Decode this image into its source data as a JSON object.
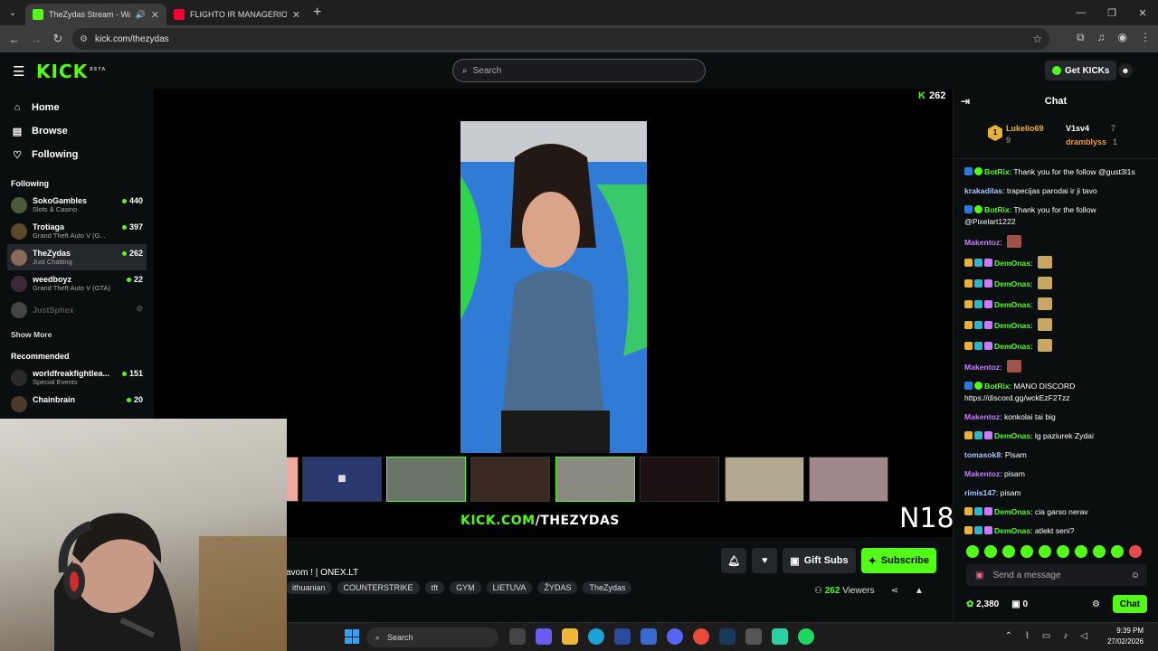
{
  "browser": {
    "tabs": [
      {
        "title": "TheZydas Stream - Watch L",
        "active": true,
        "audio": "🔊"
      },
      {
        "title": "FLIGHTO IR MANAGERIO PIRM",
        "active": false
      }
    ],
    "url": "kick.com/thezydas"
  },
  "header": {
    "logo": "KICK",
    "logo_beta": "BETA",
    "search_placeholder": "Search",
    "get_kicks": "Get KICKs"
  },
  "sidebar": {
    "nav": [
      {
        "label": "Home",
        "icon": "home-icon"
      },
      {
        "label": "Browse",
        "icon": "browse-icon"
      },
      {
        "label": "Following",
        "icon": "heart-icon"
      }
    ],
    "following_title": "Following",
    "following": [
      {
        "name": "SokoGambles",
        "category": "Slots & Casino",
        "viewers": "440"
      },
      {
        "name": "Trotiaga",
        "category": "Grand Theft Auto V (G...",
        "viewers": "397"
      },
      {
        "name": "TheZydas",
        "category": "Just Chatting",
        "viewers": "262",
        "selected": true
      },
      {
        "name": "weedboyz",
        "category": "Grand Theft Auto V (GTA)",
        "viewers": "22"
      },
      {
        "name": "JustSphex",
        "category": "",
        "viewers": "",
        "offline": true
      }
    ],
    "show_more": "Show More",
    "recommended_title": "Recommended",
    "recommended": [
      {
        "name": "worldfreakfightlea...",
        "category": "Special Events",
        "viewers": "151"
      },
      {
        "name": "Chainbrain",
        "category": "",
        "viewers": "20"
      }
    ]
  },
  "player": {
    "viewer_count": "262",
    "watermark_green": "KICK.COM",
    "watermark_white": "/THEZYDAS",
    "rating": "N18"
  },
  "stream_info": {
    "title": "avom ! | ONEX.LT",
    "tags": [
      "ithuanian",
      "COUNTERSTRIKE",
      "tft",
      "GYM",
      "LIETUVA",
      "ŽYDAS",
      "TheZydas"
    ],
    "gift_subs": "Gift Subs",
    "subscribe": "Subscribe",
    "viewers_count": "262",
    "viewers_label": "Viewers"
  },
  "chat": {
    "title": "Chat",
    "leaders": [
      {
        "rank": "1",
        "name": "Lukelio69",
        "count": "9"
      },
      {
        "name": "V1sv4",
        "count": "7"
      },
      {
        "name": "dramblyss",
        "count": "1"
      }
    ],
    "messages": [
      {
        "user": "BotRix",
        "color": "#53fc18",
        "text": "Thank you for the follow @gust3l1s",
        "bot": true
      },
      {
        "user": "krakadilas",
        "color": "#a7c8ff",
        "text": "trapecijas parodai ir ji tavo"
      },
      {
        "user": "BotRix",
        "color": "#53fc18",
        "text": "Thank you for the follow @Pixelart1222",
        "bot": true
      },
      {
        "user": "Makentoz",
        "color": "#c57cff",
        "text": "",
        "emote": true
      },
      {
        "user": "DemOnas",
        "color": "#53fc18",
        "text": "",
        "emote": true,
        "badges": true
      },
      {
        "user": "DemOnas",
        "color": "#53fc18",
        "text": "",
        "emote": true,
        "badges": true
      },
      {
        "user": "DemOnas",
        "color": "#53fc18",
        "text": "",
        "emote": true,
        "badges": true
      },
      {
        "user": "DemOnas",
        "color": "#53fc18",
        "text": "",
        "emote": true,
        "badges": true
      },
      {
        "user": "DemOnas",
        "color": "#53fc18",
        "text": "",
        "emote": true,
        "badges": true
      },
      {
        "user": "Makentoz",
        "color": "#c57cff",
        "text": "",
        "emote": true
      },
      {
        "user": "BotRix",
        "color": "#53fc18",
        "text": "MANO DISCORD https://discord.gg/wckEzF2Tzz",
        "bot": true
      },
      {
        "user": "Makentoz",
        "color": "#c57cff",
        "text": "konkolai tai big"
      },
      {
        "user": "DemOnas",
        "color": "#53fc18",
        "text": "lg paziurek Zydai",
        "badges": true
      },
      {
        "user": "tomasok8",
        "color": "#a7c8ff",
        "text": "Pisam"
      },
      {
        "user": "Makentoz",
        "color": "#c57cff",
        "text": "pisam"
      },
      {
        "user": "rimis147",
        "color": "#a7c8ff",
        "text": "pisam"
      },
      {
        "user": "DemOnas",
        "color": "#53fc18",
        "text": "cia garso nerav",
        "badges": true
      },
      {
        "user": "DemOnas",
        "color": "#53fc18",
        "text": "atlekt seni?",
        "badges": true
      }
    ],
    "send_placeholder": "Send a message",
    "points": "2,380",
    "gifts": "0",
    "chat_button": "Chat"
  },
  "taskbar": {
    "search": "Search",
    "time": "9:39 PM",
    "date": "27/02/2026"
  },
  "colors": {
    "kick_green": "#53fc18",
    "background": "#0b0e0f",
    "panel": "#24272c"
  }
}
